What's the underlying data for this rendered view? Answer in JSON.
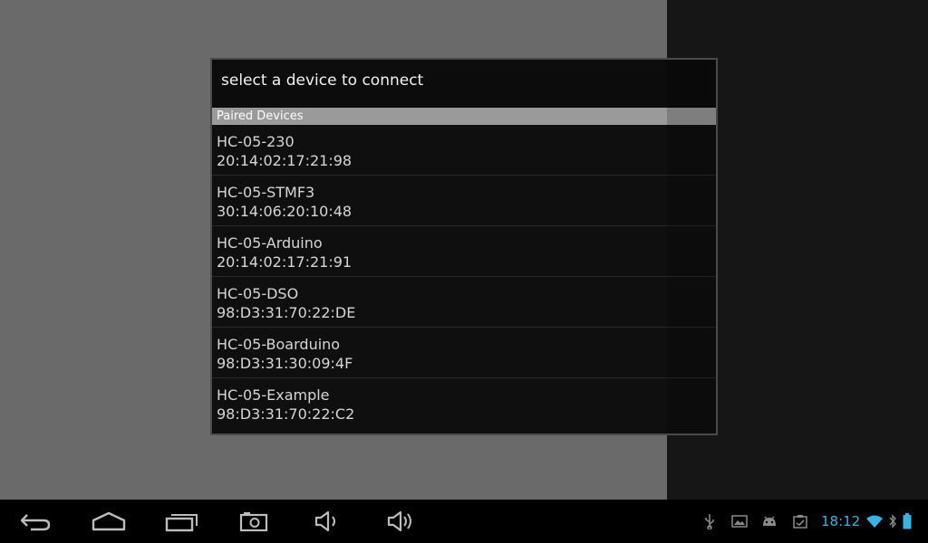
{
  "dialog": {
    "title": "select a device to connect",
    "section_header": "Paired Devices",
    "devices": [
      {
        "name": "HC-05-230",
        "address": "20:14:02:17:21:98"
      },
      {
        "name": "HC-05-STMF3",
        "address": "30:14:06:20:10:48"
      },
      {
        "name": "HC-05-Arduino",
        "address": "20:14:02:17:21:91"
      },
      {
        "name": "HC-05-DSO",
        "address": "98:D3:31:70:22:DE"
      },
      {
        "name": "HC-05-Boarduino",
        "address": "98:D3:31:30:09:4F"
      },
      {
        "name": "HC-05-Example",
        "address": "98:D3:31:70:22:C2"
      }
    ]
  },
  "navbar": {
    "buttons": [
      "back-icon",
      "home-icon",
      "recent-apps-icon",
      "screenshot-icon",
      "volume-down-icon",
      "volume-up-icon"
    ]
  },
  "status_bar": {
    "icons": [
      "usb-icon",
      "gallery-icon",
      "android-debug-icon",
      "clipboard-icon",
      "wifi-icon",
      "bluetooth-icon",
      "battery-icon"
    ],
    "time": "18:12",
    "accent_color": "#33b5e5"
  }
}
